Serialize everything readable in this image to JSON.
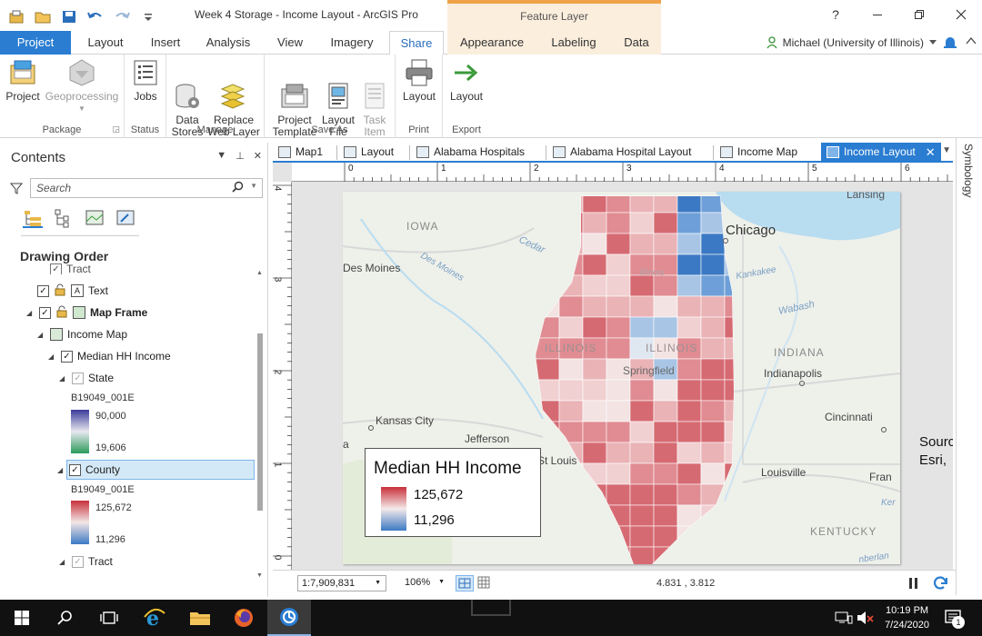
{
  "window": {
    "title": "Week 4 Storage - Income Layout - ArcGIS Pro",
    "context_tab_group": "Feature Layer",
    "help_label": "?"
  },
  "ribbon_tabs": [
    "Project",
    "Layout",
    "Insert",
    "Analysis",
    "View",
    "Imagery",
    "Share",
    "Appearance",
    "Labeling",
    "Data"
  ],
  "active_tab": "Share",
  "user": {
    "name": "Michael (University of Illinois)"
  },
  "ribbon": {
    "package": {
      "label": "Package",
      "buttons": [
        "Project",
        "Geoprocessing"
      ]
    },
    "status": {
      "label": "Status",
      "buttons": [
        "Jobs"
      ]
    },
    "manage": {
      "label": "Manage",
      "buttons": [
        "Data\nStores",
        "Replace\nWeb Layer"
      ]
    },
    "save_as": {
      "label": "Save As",
      "buttons": [
        "Project\nTemplate",
        "Layout\nFile",
        "Task\nItem"
      ]
    },
    "print": {
      "label": "Print",
      "buttons": [
        "Layout"
      ]
    },
    "export": {
      "label": "Export",
      "buttons": [
        "Layout"
      ]
    }
  },
  "contents": {
    "title": "Contents",
    "search_placeholder": "Search",
    "drawing_order_label": "Drawing Order",
    "rows": {
      "tract_top": "Tract",
      "text": "Text",
      "map_frame": "Map Frame",
      "income_map": "Income Map",
      "median_hh_income": "Median HH Income",
      "state": "State",
      "county": "County",
      "tract": "Tract"
    },
    "state_legend": {
      "field": "B19049_001E",
      "high": "90,000",
      "low": "19,606"
    },
    "county_legend": {
      "field": "B19049_001E",
      "high": "125,672",
      "low": "11,296"
    }
  },
  "doc_tabs": [
    "Map1",
    "Layout",
    "Alabama Hospitals",
    "Alabama Hospital Layout",
    "Income Map",
    "Income Layout"
  ],
  "active_doc_tab": "Income Layout",
  "rulers": {
    "h_ticks": [
      "0",
      "1",
      "2",
      "3",
      "4",
      "5",
      "6"
    ],
    "v_ticks": [
      "4",
      "3",
      "2",
      "1",
      "0"
    ]
  },
  "map": {
    "labels": {
      "lansing": "Lansing",
      "iowa": "IOWA",
      "cedar": "Cedar",
      "chicago": "Chicago",
      "des_moines": "Des Moines",
      "des_moines_river": "Des Moines",
      "illinois_faint": "Illinois",
      "kankakee": "Kankakee",
      "wabash": "Wabash",
      "illinois_state_1": "ILLINOIS",
      "illinois_state_2": "ILLINOIS",
      "indiana": "INDIANA",
      "springfield": "Springfield",
      "indianapolis": "Indianapolis",
      "kansas_city": "Kansas City",
      "cincinnati": "Cincinnati",
      "a": "a",
      "jefferson": "Jefferson",
      "st_louis": "St Louis",
      "louisville": "Louisville",
      "fran": "Fran",
      "ker": "Ker",
      "kentucky": "KENTUCKY",
      "nberlan": "nberlan"
    },
    "legend": {
      "title": "Median HH Income",
      "high": "125,672",
      "low": "11,296"
    }
  },
  "source_text": {
    "line1": "Sourc",
    "line2": "Esri,"
  },
  "statusbar": {
    "scale": "1:7,909,831",
    "zoom": "106%",
    "coordinates": "4.831 , 3.812"
  },
  "rail": {
    "label": "Symbology"
  },
  "taskbar": {
    "time": "10:19 PM",
    "date": "7/24/2020",
    "notification_count": "1"
  },
  "colors": {
    "accent": "#2a7dd1",
    "high_income": "#c8303a",
    "low_income": "#3c79c4",
    "context_tab": "#fbeedd"
  }
}
